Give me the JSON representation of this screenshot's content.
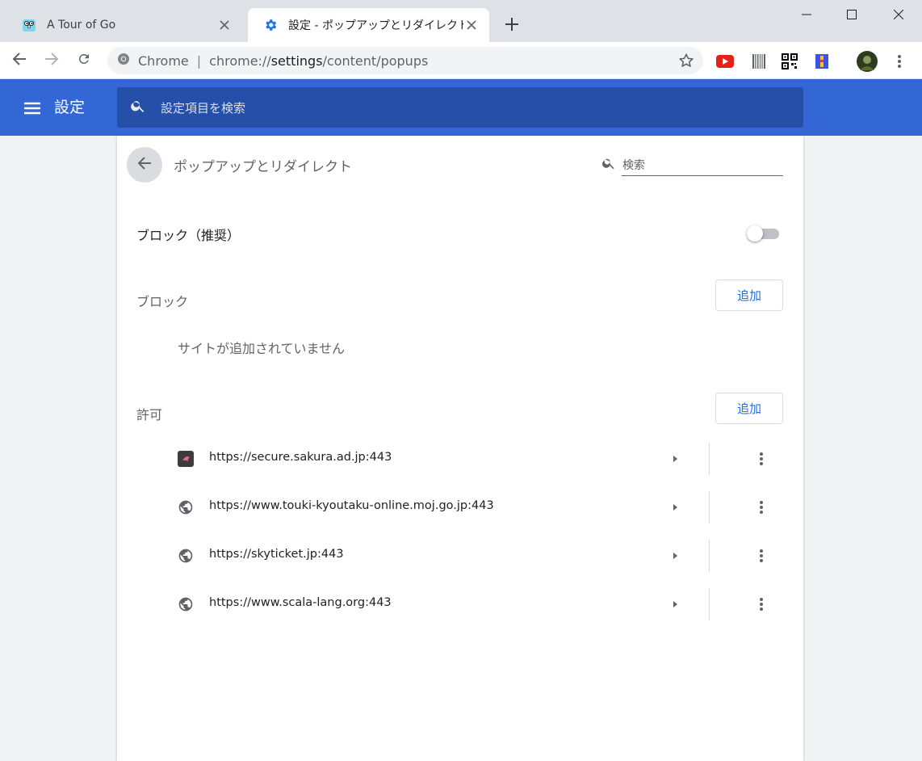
{
  "tabs": [
    {
      "title": "A Tour of Go",
      "icon": "gopher-icon",
      "active": false
    },
    {
      "title": "設定 - ポップアップとリダイレクト",
      "icon": "gear-icon",
      "active": true
    }
  ],
  "omnibox": {
    "scheme_label": "Chrome",
    "url_prefix": "chrome://",
    "url_host": "settings",
    "url_path": "/content/popups"
  },
  "header": {
    "title": "設定",
    "search_placeholder": "設定項目を検索"
  },
  "page": {
    "title": "ポップアップとリダイレクト",
    "search_placeholder": "検索",
    "toggle_label": "ブロック（推奨）",
    "toggle_on": false,
    "block_section": {
      "label": "ブロック",
      "add_label": "追加",
      "empty_message": "サイトが追加されていません"
    },
    "allow_section": {
      "label": "許可",
      "add_label": "追加",
      "sites": [
        {
          "url": "https://secure.sakura.ad.jp:443",
          "icon": "sakura-favicon"
        },
        {
          "url": "https://www.touki-kyoutaku-online.moj.go.jp:443",
          "icon": "globe-icon"
        },
        {
          "url": "https://skyticket.jp:443",
          "icon": "globe-icon"
        },
        {
          "url": "https://www.scala-lang.org:443",
          "icon": "globe-icon"
        }
      ]
    }
  },
  "colors": {
    "header_blue": "#3367d6",
    "search_blue": "#254fa8",
    "link_blue": "#1a73e8"
  }
}
